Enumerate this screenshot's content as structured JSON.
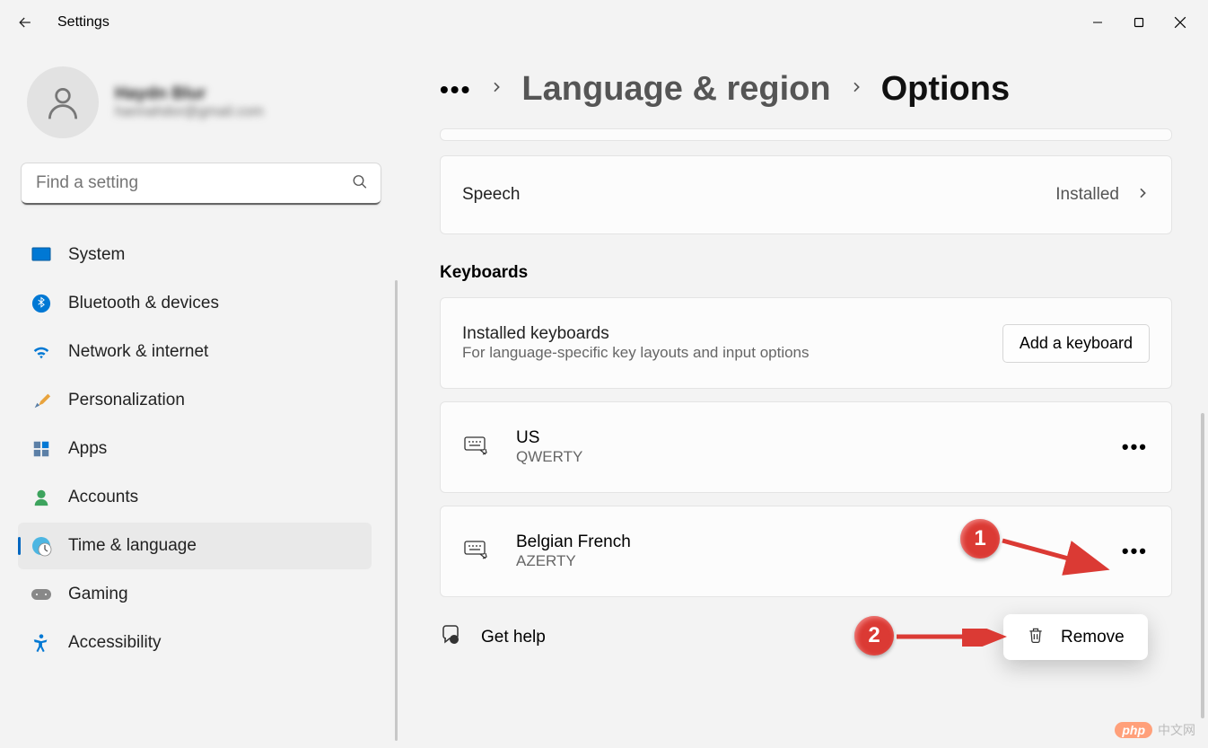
{
  "titlebar": {
    "title": "Settings"
  },
  "profile": {
    "name": "Haydn Blur",
    "email": "hannahdor@gmail.com"
  },
  "search": {
    "placeholder": "Find a setting"
  },
  "nav": [
    {
      "id": "system",
      "label": "System"
    },
    {
      "id": "bluetooth",
      "label": "Bluetooth & devices"
    },
    {
      "id": "network",
      "label": "Network & internet"
    },
    {
      "id": "personalization",
      "label": "Personalization"
    },
    {
      "id": "apps",
      "label": "Apps"
    },
    {
      "id": "accounts",
      "label": "Accounts"
    },
    {
      "id": "time-language",
      "label": "Time & language",
      "active": true
    },
    {
      "id": "gaming",
      "label": "Gaming"
    },
    {
      "id": "accessibility",
      "label": "Accessibility"
    }
  ],
  "breadcrumb": {
    "more": "•••",
    "parent": "Language & region",
    "current": "Options"
  },
  "speech_card": {
    "title": "Speech",
    "status": "Installed"
  },
  "keyboards_section": {
    "title": "Keyboards",
    "header": {
      "title": "Installed keyboards",
      "subtitle": "For language-specific key layouts and input options",
      "button": "Add a keyboard"
    },
    "items": [
      {
        "name": "US",
        "layout": "QWERTY"
      },
      {
        "name": "Belgian French",
        "layout": "AZERTY"
      }
    ]
  },
  "popup": {
    "remove": "Remove"
  },
  "help": {
    "label": "Get help"
  },
  "callouts": {
    "one": "1",
    "two": "2"
  },
  "watermark": {
    "logo": "php",
    "text": "中文网"
  }
}
